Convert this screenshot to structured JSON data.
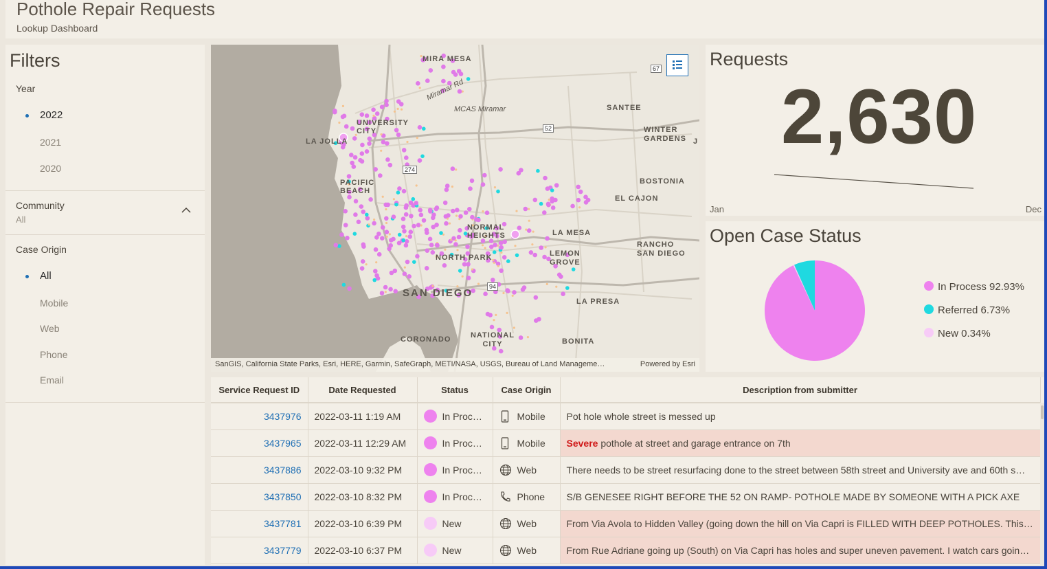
{
  "header": {
    "title": "Pothole Repair Requests",
    "subtitle": "Lookup Dashboard"
  },
  "filters": {
    "title": "Filters",
    "year": {
      "label": "Year",
      "options": [
        "2022",
        "2021",
        "2020"
      ],
      "selected": "2022"
    },
    "community": {
      "label": "Community",
      "value": "All"
    },
    "case_origin": {
      "label": "Case Origin",
      "options": [
        "All",
        "Mobile",
        "Web",
        "Phone",
        "Email"
      ],
      "selected": "All"
    }
  },
  "map": {
    "labels": {
      "mira_mesa": "MIRA MESA",
      "miramar_rd": "Miramar Rd",
      "mcas_miramar": "MCAS Miramar",
      "santee": "SANTEE",
      "university_city": "UNIVERSITY CITY",
      "la_jolla": "LA JOLLA",
      "winter_gardens": "WINTER GARDENS",
      "pacific_beach": "PACIFIC BEACH",
      "boston": "BOSTONIA",
      "el_cajon": "EL CAJON",
      "normal_heights": "NORMAL HEIGHTS",
      "la_mesa": "LA MESA",
      "rancho_san_diego": "RANCHO SAN DIEGO",
      "north_park": "NORTH PARK",
      "lemon_grove": "LEMON GROVE",
      "san_diego": "SAN DIEGO",
      "la_presa": "LA PRESA",
      "coronado": "CORONADO",
      "national_city": "NATIONAL CITY",
      "bonita": "BONITA",
      "jamul": "J"
    },
    "highways": [
      "67",
      "52",
      "274",
      "94"
    ],
    "attribution": "SanGIS, California State Parks, Esri, HERE, Garmin, SafeGraph, METI/NASA, USGS, Bureau of Land Manageme…",
    "powered_by": "Powered by Esri",
    "legend_icon": "legend-list-icon"
  },
  "requests": {
    "title": "Requests",
    "value": "2,630",
    "axis_start": "Jan",
    "axis_end": "Dec"
  },
  "open_case_status": {
    "title": "Open Case Status",
    "chart_data": {
      "type": "pie",
      "slices": [
        {
          "name": "In Process",
          "percent": 92.93,
          "color": "#ee82ee"
        },
        {
          "name": "Referred",
          "percent": 6.73,
          "color": "#1fd9e0"
        },
        {
          "name": "New",
          "percent": 0.34,
          "color": "#f7cbf7"
        }
      ]
    },
    "legend": [
      "In Process 92.93%",
      "Referred 6.73%",
      "New 0.34%"
    ]
  },
  "table": {
    "columns": [
      "Service Request ID",
      "Date Requested",
      "Status",
      "Case Origin",
      "Description from submitter"
    ],
    "rows": [
      {
        "id": "3437976",
        "date": "2022-03-11 1:19 AM",
        "status": "In Process",
        "origin": "Mobile",
        "origin_icon": "mobile-icon",
        "desc_strong": "",
        "desc": "Pot hole whole street is messed up",
        "highlight": false
      },
      {
        "id": "3437965",
        "date": "2022-03-11 12:29 AM",
        "status": "In Process",
        "origin": "Mobile",
        "origin_icon": "mobile-icon",
        "desc_strong": "Severe",
        "desc": " pothole at street and garage entrance on 7th",
        "highlight": true
      },
      {
        "id": "3437886",
        "date": "2022-03-10 9:32 PM",
        "status": "In Process",
        "origin": "Web",
        "origin_icon": "globe-icon",
        "desc_strong": "",
        "desc": "There needs to be street resurfacing done to the street between 58th street and University ave and 60th s…",
        "highlight": false
      },
      {
        "id": "3437850",
        "date": "2022-03-10 8:32 PM",
        "status": "In Process",
        "origin": "Phone",
        "origin_icon": "phone-icon",
        "desc_strong": "",
        "desc": "S/B GENESEE RIGHT BEFORE THE 52 ON RAMP- POTHOLE MADE BY SOMEONE WITH A PICK AXE",
        "highlight": false
      },
      {
        "id": "3437781",
        "date": "2022-03-10 6:39 PM",
        "status": "New",
        "origin": "Web",
        "origin_icon": "globe-icon",
        "desc_strong": "",
        "desc": "From Via Avola to Hidden Valley (going down the hill on Via Capri is FILLED WITH DEEP POTHOLES. This …",
        "highlight": true
      },
      {
        "id": "3437779",
        "date": "2022-03-10 6:37 PM",
        "status": "New",
        "origin": "Web",
        "origin_icon": "globe-icon",
        "desc_strong": "",
        "desc": "From Rue Adriane going up (South) on Via Capri has holes and super uneven pavement. I watch cars goin…",
        "highlight": true
      }
    ]
  },
  "colors": {
    "in_process": "#ee82ee",
    "referred": "#1fd9e0",
    "new": "#f7cbf7",
    "link": "#1f6fb4",
    "severe": "#d01818"
  }
}
